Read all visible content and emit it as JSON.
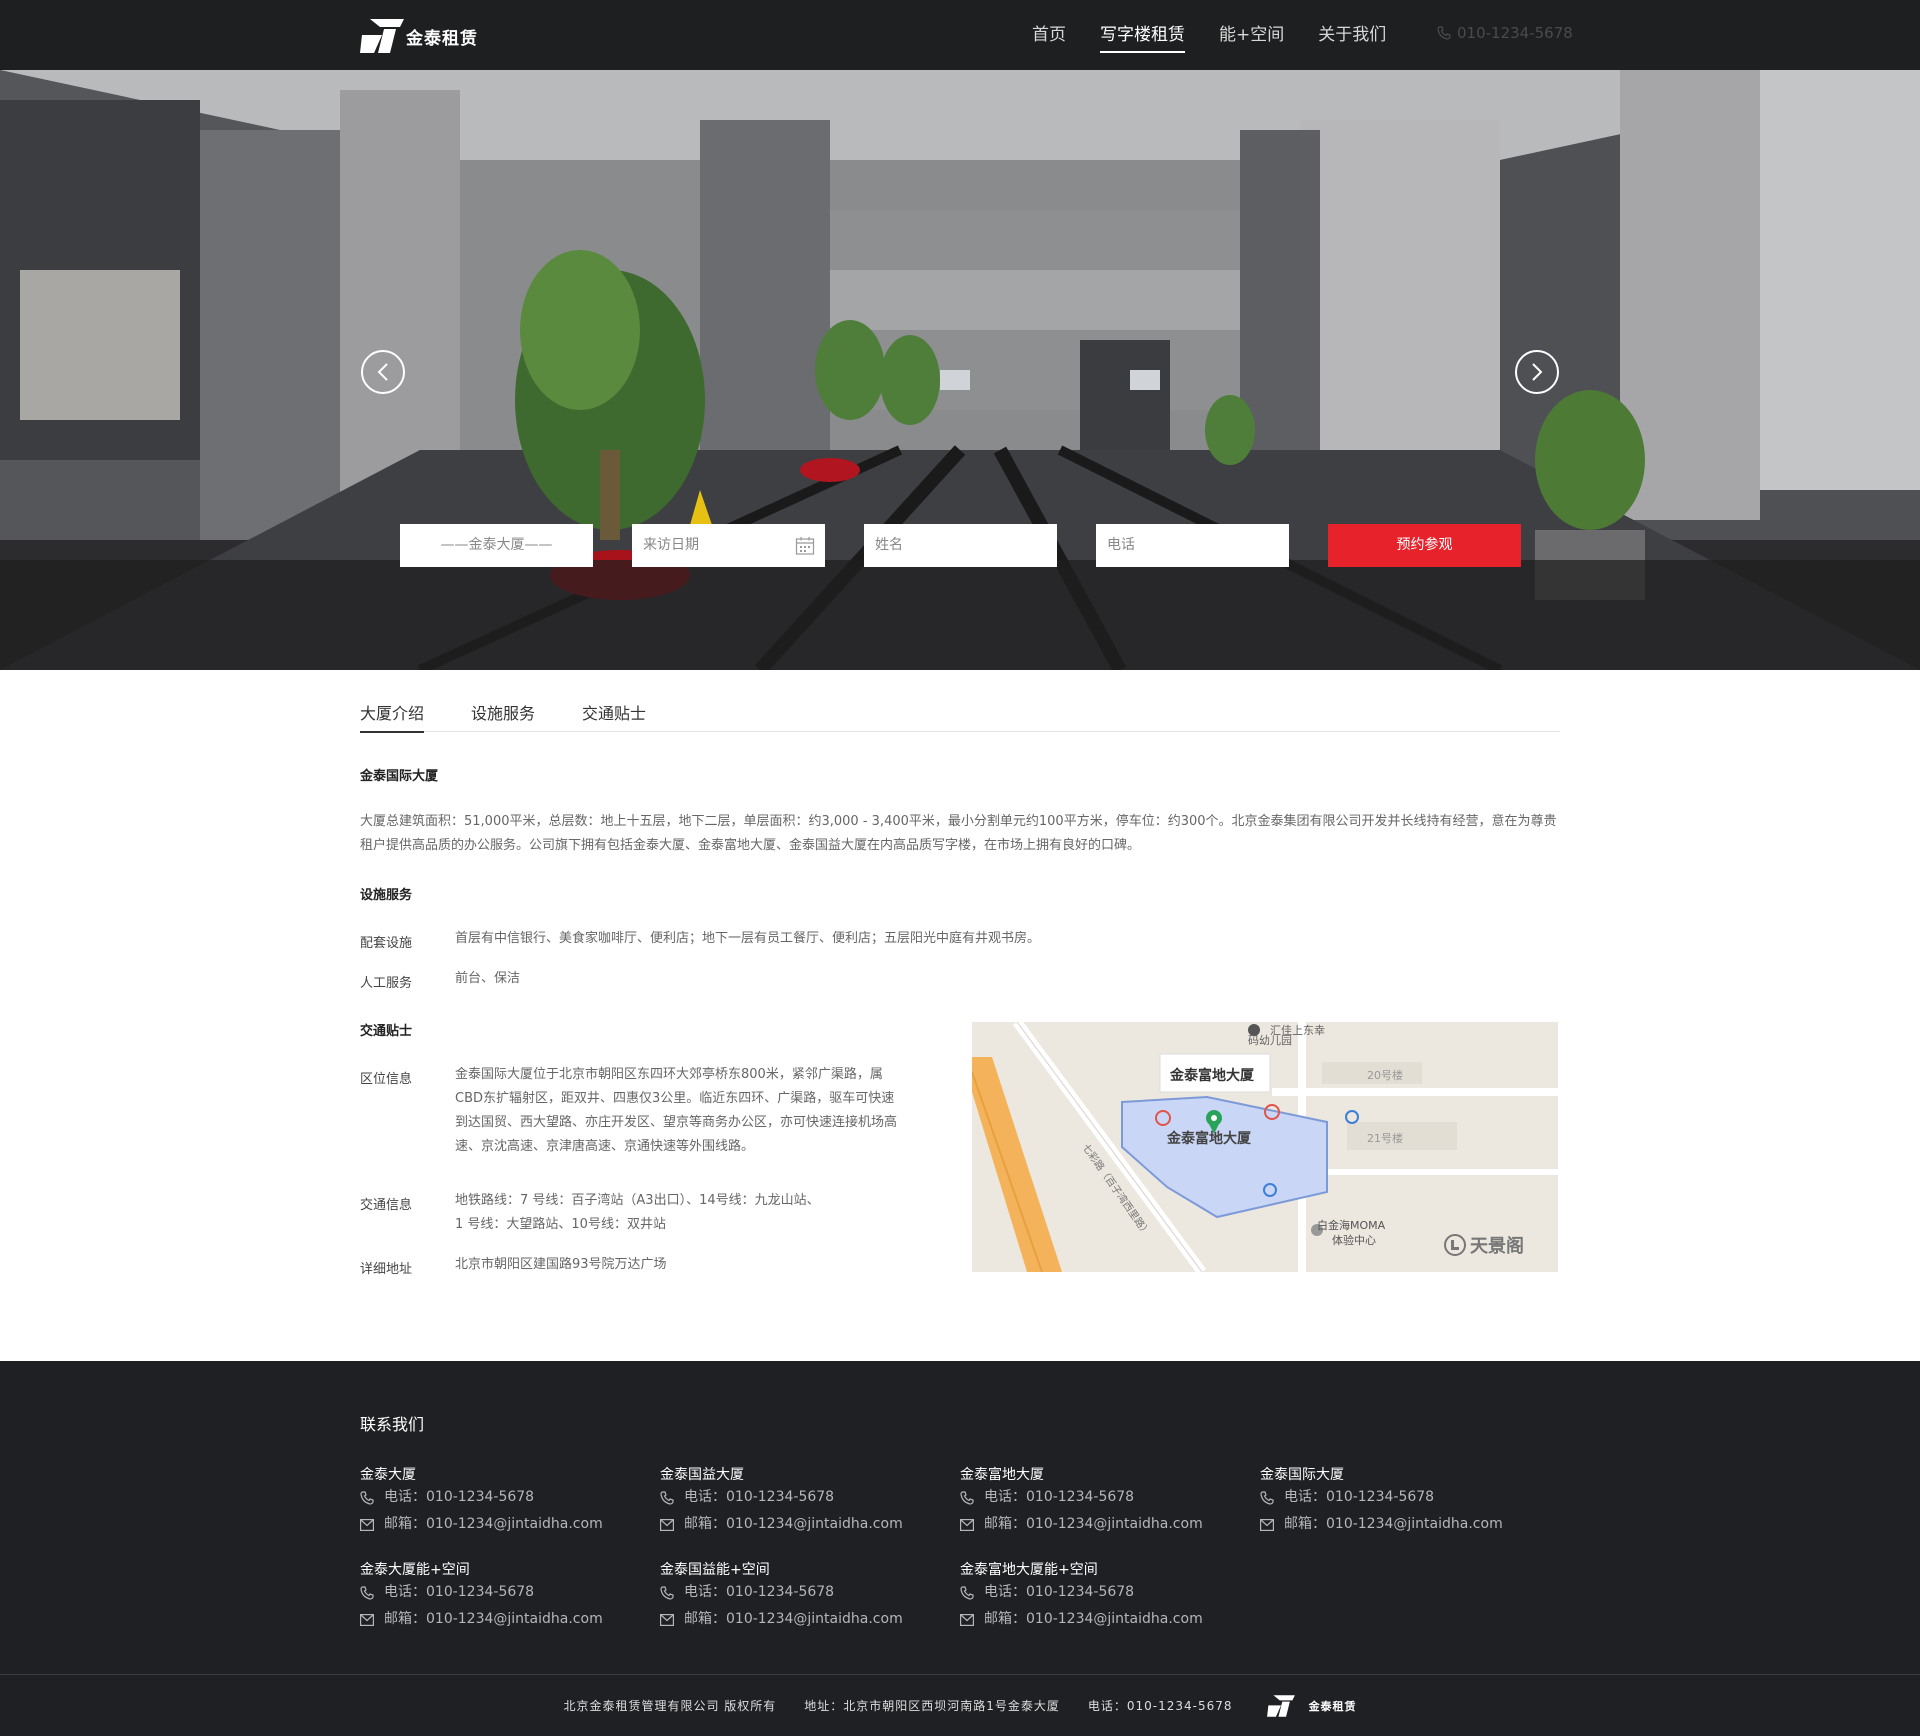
{
  "header": {
    "logo_text": "金泰租赁",
    "nav": [
      "首页",
      "写字楼租赁",
      "能+空间",
      "关于我们"
    ],
    "active_nav": "写字楼租赁",
    "phone": "010-1234-5678"
  },
  "booking": {
    "building_value": "——金泰大厦——",
    "date_placeholder": "来访日期",
    "name_placeholder": "姓名",
    "phone_placeholder": "电话",
    "submit_label": "预约参观"
  },
  "tabs": [
    "大厦介绍",
    "设施服务",
    "交通贴士"
  ],
  "intro": {
    "title": "金泰国际大厦",
    "text": "大厦总建筑面积：51,000平米，总层数：地上十五层，地下二层，单层面积：约3,000 - 3,400平米，最小分割单元约100平方米，停车位：约300个。北京金泰集团有限公司开发并长线持有经营，意在为尊贵租户提供高品质的办公服务。公司旗下拥有包括金泰大厦、金泰富地大厦、金泰国益大厦在内高品质写字楼，在市场上拥有良好的口碑。"
  },
  "facilities": {
    "title": "设施服务",
    "rows": [
      {
        "label": "配套设施",
        "value": "首层有中信银行、美食家咖啡厅、便利店；地下一层有员工餐厅、便利店；五层阳光中庭有井观书房。"
      },
      {
        "label": "人工服务",
        "value": "前台、保洁"
      }
    ]
  },
  "traffic": {
    "title": "交通贴士",
    "location_label": "区位信息",
    "location_lines": [
      "金泰国际大厦位于北京市朝阳区东四环大郊亭桥东800米，紧邻广渠路，属",
      "CBD东扩辐射区，距双井、四惠仅3公里。临近东四环、广渠路，驱车可快速",
      "到达国贸、西大望路、亦庄开发区、望京等商务办公区，亦可快速连接机场高",
      "速、京沈高速、京津唐高速、京通快速等外围线路。"
    ],
    "transit_label": "交通信息",
    "transit_lines": [
      "地铁路线：7 号线：百子湾站（A3出口）、14号线：九龙山站、",
      "1 号线：大望路站、10号线：双井站"
    ],
    "address_label": "详细地址",
    "address": "北京市朝阳区建国路93号院万达广场"
  },
  "map": {
    "callout": "金泰富地大厦",
    "building_label": "金泰富地大厦",
    "labels": {
      "kindergarten": "码幼儿园",
      "top": "汇佳上东幸",
      "b20": "20号楼",
      "b21": "21号楼",
      "moma1": "白金海MOMA",
      "moma2": "体验中心",
      "road": "七彩路（百子湾西里路）",
      "brand": "天景阁"
    }
  },
  "footer": {
    "title": "联系我们",
    "contacts": [
      {
        "name": "金泰大厦",
        "phone": "电话：010-1234-5678",
        "email": "邮箱：010-1234@jintaidha.com"
      },
      {
        "name": "金泰国益大厦",
        "phone": "电话：010-1234-5678",
        "email": "邮箱：010-1234@jintaidha.com"
      },
      {
        "name": "金泰富地大厦",
        "phone": "电话：010-1234-5678",
        "email": "邮箱：010-1234@jintaidha.com"
      },
      {
        "name": "金泰国际大厦",
        "phone": "电话：010-1234-5678",
        "email": "邮箱：010-1234@jintaidha.com"
      },
      {
        "name": "金泰大厦能+空间",
        "phone": "电话：010-1234-5678",
        "email": "邮箱：010-1234@jintaidha.com"
      },
      {
        "name": "金泰国益能+空间",
        "phone": "电话：010-1234-5678",
        "email": "邮箱：010-1234@jintaidha.com"
      },
      {
        "name": "金泰富地大厦能+空间",
        "phone": "电话：010-1234-5678",
        "email": "邮箱：010-1234@jintaidha.com"
      }
    ],
    "copyright": "北京金泰租赁管理有限公司  版权所有",
    "address": "地址：北京市朝阳区西坝河南路1号金泰大厦",
    "phone": "电话：010-1234-5678",
    "logo_text": "金泰租赁"
  }
}
